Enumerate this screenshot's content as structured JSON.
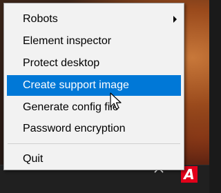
{
  "menu": {
    "items": [
      {
        "label": "Robots",
        "has_submenu": true
      },
      {
        "label": "Element inspector"
      },
      {
        "label": "Protect desktop"
      },
      {
        "label": "Create support image",
        "highlighted": true
      },
      {
        "label": "Generate config file"
      },
      {
        "label": "Password encryption"
      },
      {
        "label": "Quit"
      }
    ]
  },
  "taskbar": {
    "tray_icons": [
      "chevron-up-icon",
      "app-logo-icon"
    ],
    "app_logo_letter": "A"
  },
  "colors": {
    "highlight": "#0078d7",
    "menu_background": "#f2f2f2",
    "app_logo": "#e1001a",
    "taskbar": "#202020"
  }
}
